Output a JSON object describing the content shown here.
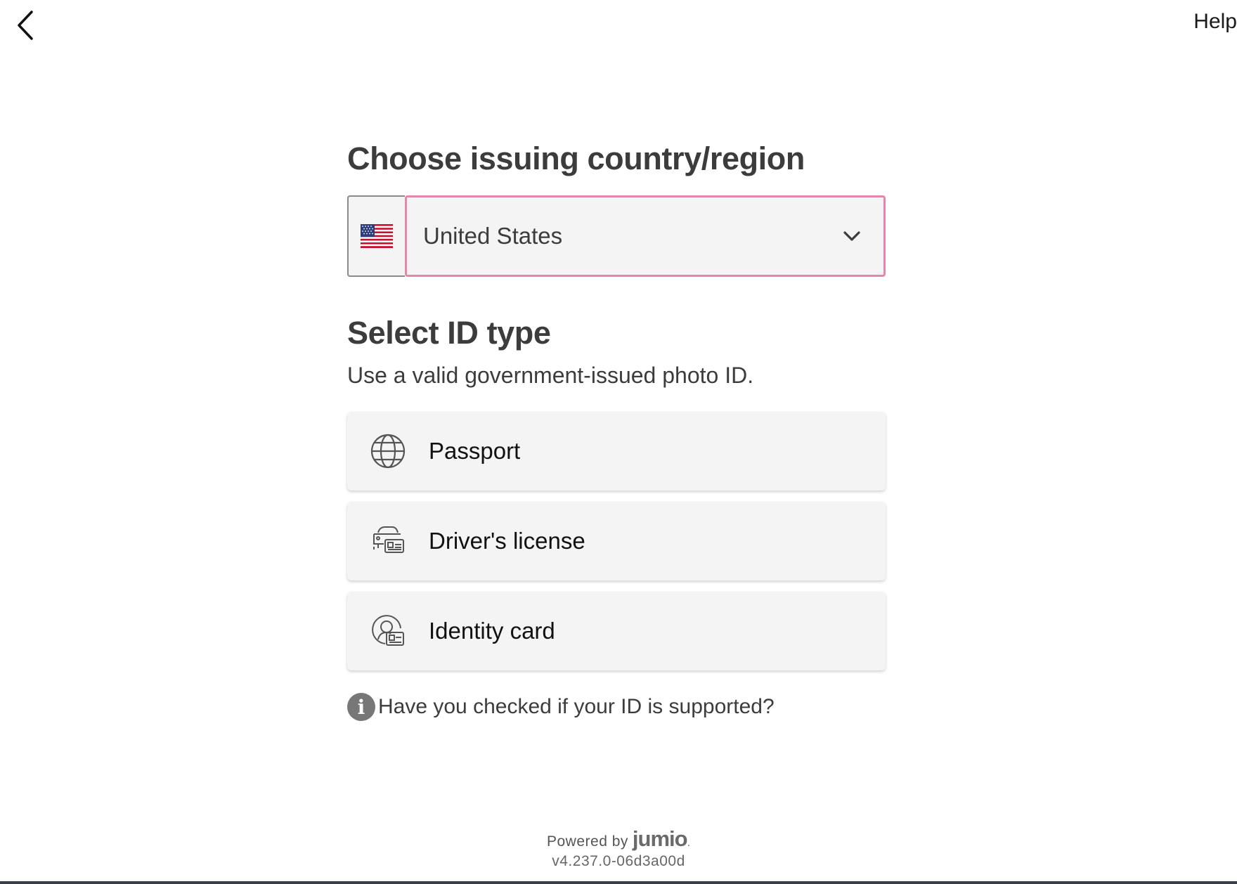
{
  "header": {
    "back_icon": "chevron-left-icon",
    "help_label": "Help"
  },
  "country": {
    "heading": "Choose issuing country/region",
    "selected": "United States",
    "flag_icon": "us-flag-icon",
    "dropdown_icon": "chevron-down-icon",
    "focus_border_color": "#e586ac"
  },
  "id_type": {
    "heading": "Select ID type",
    "subtitle": "Use a valid government-issued photo ID.",
    "options": [
      {
        "label": "Passport",
        "icon": "globe-icon"
      },
      {
        "label": "Driver's license",
        "icon": "car-license-icon"
      },
      {
        "label": "Identity card",
        "icon": "person-card-icon"
      }
    ]
  },
  "support": {
    "icon": "info-icon",
    "text": "Have you checked if your ID is supported?"
  },
  "footer": {
    "powered_by": "Powered by",
    "brand": "jumio",
    "version": "v4.237.0-06d3a00d"
  }
}
